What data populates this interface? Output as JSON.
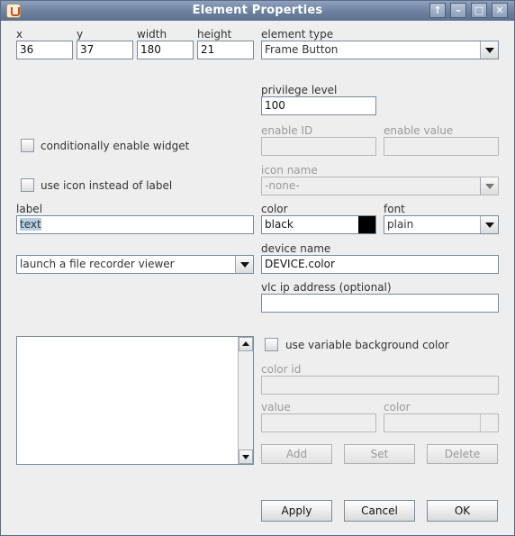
{
  "window": {
    "title": "Element Properties"
  },
  "position": {
    "x": {
      "label": "x",
      "value": "36"
    },
    "y": {
      "label": "y",
      "value": "37"
    },
    "width": {
      "label": "width",
      "value": "180"
    },
    "height": {
      "label": "height",
      "value": "21"
    }
  },
  "element_type": {
    "label": "element type",
    "value": "Frame Button"
  },
  "privilege_level": {
    "label": "privilege level",
    "value": "100"
  },
  "conditional": {
    "label": "conditionally enable widget",
    "checked": false
  },
  "enable_id": {
    "label": "enable ID",
    "value": ""
  },
  "enable_value": {
    "label": "enable value",
    "value": ""
  },
  "use_icon": {
    "label": "use icon instead of label",
    "checked": false
  },
  "icon_name": {
    "label": "icon name",
    "value": "-none-"
  },
  "label_field": {
    "label": "label",
    "value": "text"
  },
  "color": {
    "label": "color",
    "value": "black",
    "swatch": "#000000"
  },
  "font": {
    "label": "font",
    "value": "plain"
  },
  "action": {
    "value": "launch a file recorder viewer"
  },
  "device_name": {
    "label": "device name",
    "value": "DEVICE.color"
  },
  "vlc": {
    "label": "vlc ip address (optional)",
    "value": ""
  },
  "variable_bg": {
    "label": "use variable background color",
    "checked": false
  },
  "color_id": {
    "label": "color id",
    "value": ""
  },
  "bg_value": {
    "label": "value",
    "value": ""
  },
  "bg_color": {
    "label": "color",
    "value": ""
  },
  "table_buttons": {
    "add": "Add",
    "set": "Set",
    "delete": "Delete"
  },
  "footer": {
    "apply": "Apply",
    "cancel": "Cancel",
    "ok": "OK"
  },
  "colors": {
    "titlebar": "#6b7f9f",
    "background": "#eeeeee",
    "text_selection": "#b8cfe5"
  }
}
